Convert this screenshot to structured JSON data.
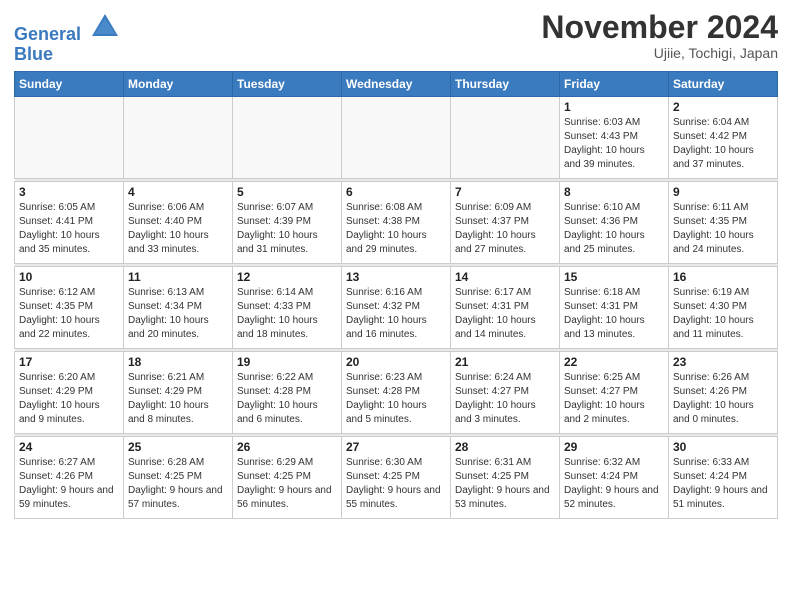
{
  "header": {
    "logo_line1": "General",
    "logo_line2": "Blue",
    "month_title": "November 2024",
    "location": "Ujiie, Tochigi, Japan"
  },
  "days_of_week": [
    "Sunday",
    "Monday",
    "Tuesday",
    "Wednesday",
    "Thursday",
    "Friday",
    "Saturday"
  ],
  "weeks": [
    [
      {
        "day": "",
        "info": ""
      },
      {
        "day": "",
        "info": ""
      },
      {
        "day": "",
        "info": ""
      },
      {
        "day": "",
        "info": ""
      },
      {
        "day": "",
        "info": ""
      },
      {
        "day": "1",
        "info": "Sunrise: 6:03 AM\nSunset: 4:43 PM\nDaylight: 10 hours and 39 minutes."
      },
      {
        "day": "2",
        "info": "Sunrise: 6:04 AM\nSunset: 4:42 PM\nDaylight: 10 hours and 37 minutes."
      }
    ],
    [
      {
        "day": "3",
        "info": "Sunrise: 6:05 AM\nSunset: 4:41 PM\nDaylight: 10 hours and 35 minutes."
      },
      {
        "day": "4",
        "info": "Sunrise: 6:06 AM\nSunset: 4:40 PM\nDaylight: 10 hours and 33 minutes."
      },
      {
        "day": "5",
        "info": "Sunrise: 6:07 AM\nSunset: 4:39 PM\nDaylight: 10 hours and 31 minutes."
      },
      {
        "day": "6",
        "info": "Sunrise: 6:08 AM\nSunset: 4:38 PM\nDaylight: 10 hours and 29 minutes."
      },
      {
        "day": "7",
        "info": "Sunrise: 6:09 AM\nSunset: 4:37 PM\nDaylight: 10 hours and 27 minutes."
      },
      {
        "day": "8",
        "info": "Sunrise: 6:10 AM\nSunset: 4:36 PM\nDaylight: 10 hours and 25 minutes."
      },
      {
        "day": "9",
        "info": "Sunrise: 6:11 AM\nSunset: 4:35 PM\nDaylight: 10 hours and 24 minutes."
      }
    ],
    [
      {
        "day": "10",
        "info": "Sunrise: 6:12 AM\nSunset: 4:35 PM\nDaylight: 10 hours and 22 minutes."
      },
      {
        "day": "11",
        "info": "Sunrise: 6:13 AM\nSunset: 4:34 PM\nDaylight: 10 hours and 20 minutes."
      },
      {
        "day": "12",
        "info": "Sunrise: 6:14 AM\nSunset: 4:33 PM\nDaylight: 10 hours and 18 minutes."
      },
      {
        "day": "13",
        "info": "Sunrise: 6:16 AM\nSunset: 4:32 PM\nDaylight: 10 hours and 16 minutes."
      },
      {
        "day": "14",
        "info": "Sunrise: 6:17 AM\nSunset: 4:31 PM\nDaylight: 10 hours and 14 minutes."
      },
      {
        "day": "15",
        "info": "Sunrise: 6:18 AM\nSunset: 4:31 PM\nDaylight: 10 hours and 13 minutes."
      },
      {
        "day": "16",
        "info": "Sunrise: 6:19 AM\nSunset: 4:30 PM\nDaylight: 10 hours and 11 minutes."
      }
    ],
    [
      {
        "day": "17",
        "info": "Sunrise: 6:20 AM\nSunset: 4:29 PM\nDaylight: 10 hours and 9 minutes."
      },
      {
        "day": "18",
        "info": "Sunrise: 6:21 AM\nSunset: 4:29 PM\nDaylight: 10 hours and 8 minutes."
      },
      {
        "day": "19",
        "info": "Sunrise: 6:22 AM\nSunset: 4:28 PM\nDaylight: 10 hours and 6 minutes."
      },
      {
        "day": "20",
        "info": "Sunrise: 6:23 AM\nSunset: 4:28 PM\nDaylight: 10 hours and 5 minutes."
      },
      {
        "day": "21",
        "info": "Sunrise: 6:24 AM\nSunset: 4:27 PM\nDaylight: 10 hours and 3 minutes."
      },
      {
        "day": "22",
        "info": "Sunrise: 6:25 AM\nSunset: 4:27 PM\nDaylight: 10 hours and 2 minutes."
      },
      {
        "day": "23",
        "info": "Sunrise: 6:26 AM\nSunset: 4:26 PM\nDaylight: 10 hours and 0 minutes."
      }
    ],
    [
      {
        "day": "24",
        "info": "Sunrise: 6:27 AM\nSunset: 4:26 PM\nDaylight: 9 hours and 59 minutes."
      },
      {
        "day": "25",
        "info": "Sunrise: 6:28 AM\nSunset: 4:25 PM\nDaylight: 9 hours and 57 minutes."
      },
      {
        "day": "26",
        "info": "Sunrise: 6:29 AM\nSunset: 4:25 PM\nDaylight: 9 hours and 56 minutes."
      },
      {
        "day": "27",
        "info": "Sunrise: 6:30 AM\nSunset: 4:25 PM\nDaylight: 9 hours and 55 minutes."
      },
      {
        "day": "28",
        "info": "Sunrise: 6:31 AM\nSunset: 4:25 PM\nDaylight: 9 hours and 53 minutes."
      },
      {
        "day": "29",
        "info": "Sunrise: 6:32 AM\nSunset: 4:24 PM\nDaylight: 9 hours and 52 minutes."
      },
      {
        "day": "30",
        "info": "Sunrise: 6:33 AM\nSunset: 4:24 PM\nDaylight: 9 hours and 51 minutes."
      }
    ]
  ]
}
